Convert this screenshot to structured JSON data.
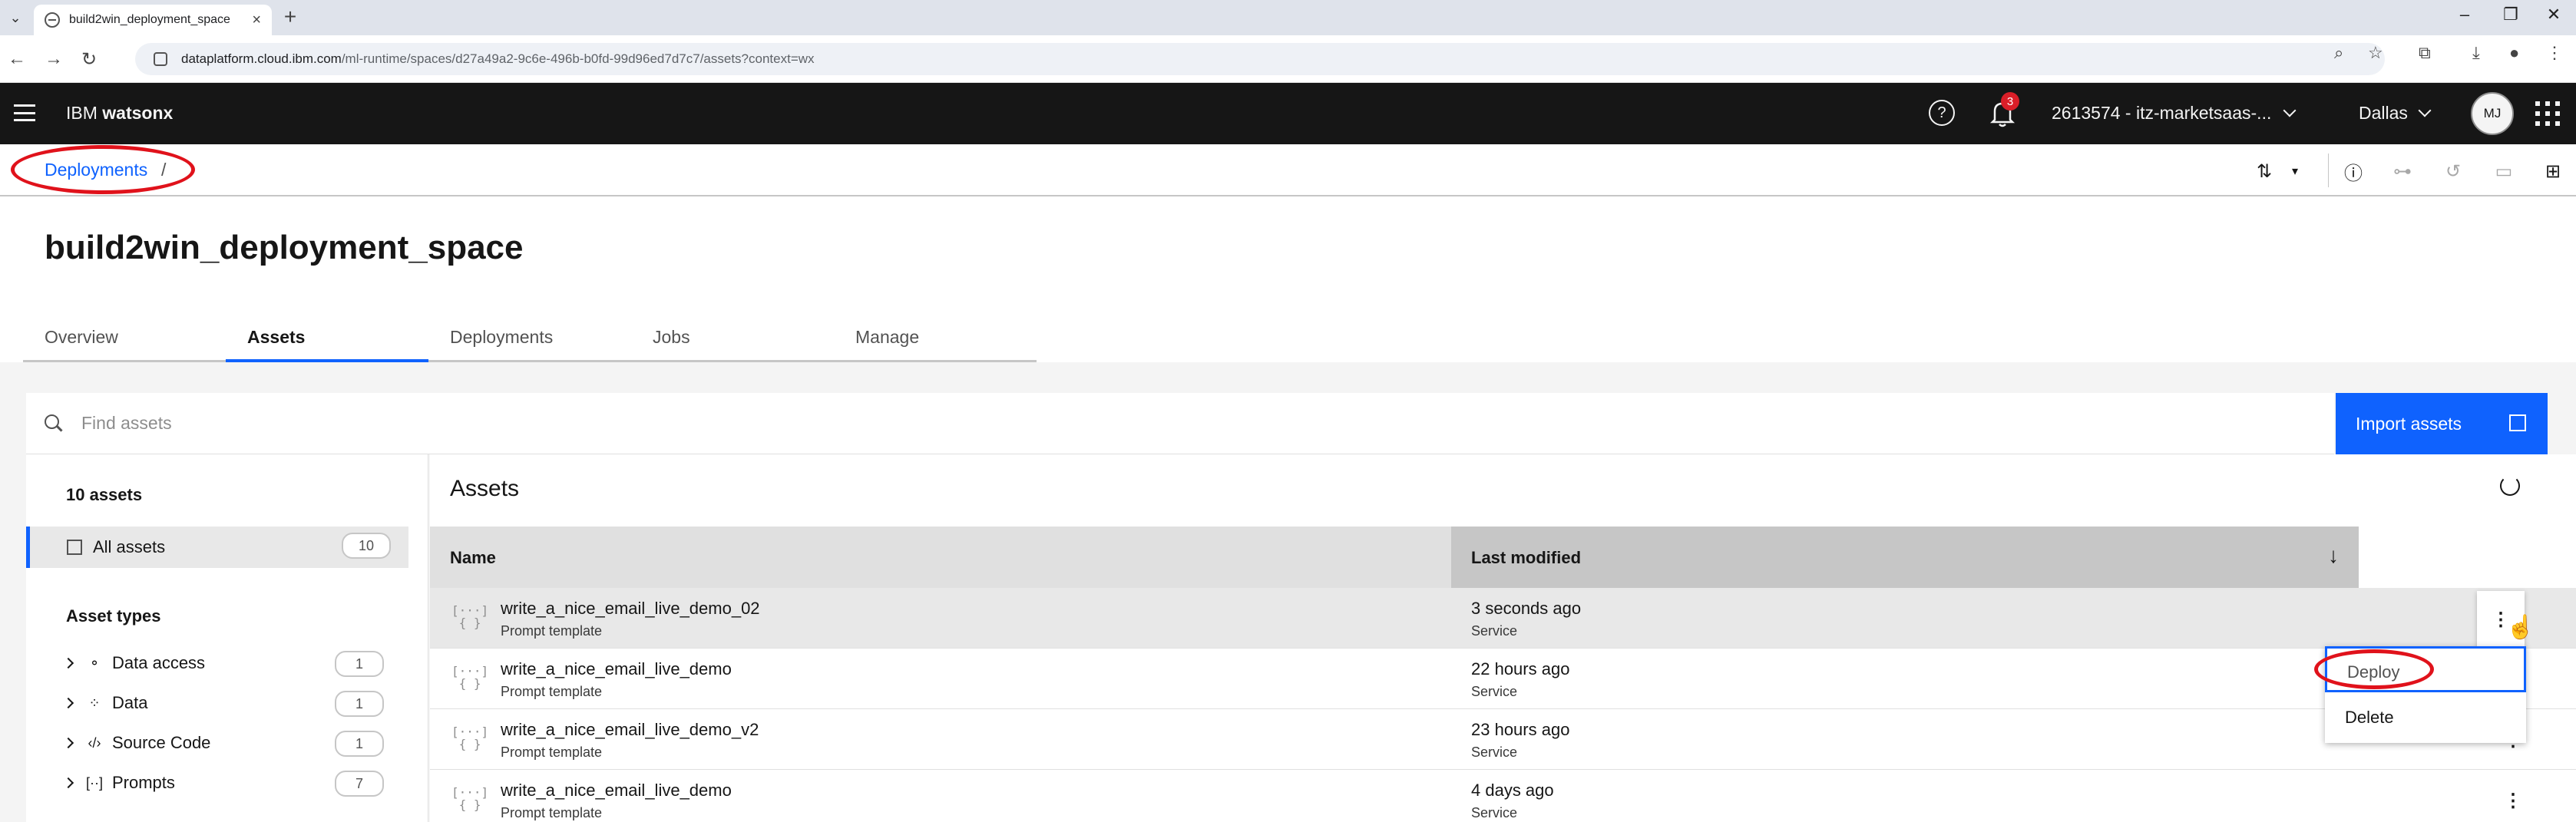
{
  "browser": {
    "tab_title": "build2win_deployment_space",
    "url_host": "dataplatform.cloud.ibm.com",
    "url_path": "/ml-runtime/spaces/d27a49a2-9c6e-496b-b0fd-99d96ed7d7c7/assets?context=wx"
  },
  "header": {
    "brand_prefix": "IBM",
    "brand_name": "watsonx",
    "notification_count": "3",
    "account": "2613574 - itz-marketsaas-...",
    "region": "Dallas",
    "avatar_initials": "MJ"
  },
  "breadcrumb": {
    "item": "Deployments",
    "separator": "/"
  },
  "page": {
    "title": "build2win_deployment_space",
    "tabs": [
      {
        "label": "Overview"
      },
      {
        "label": "Assets"
      },
      {
        "label": "Deployments"
      },
      {
        "label": "Jobs"
      },
      {
        "label": "Manage"
      }
    ]
  },
  "search": {
    "placeholder": "Find assets"
  },
  "import_button": {
    "label": "Import assets"
  },
  "sidebar": {
    "count_label": "10 assets",
    "all_assets": {
      "label": "All assets",
      "count": "10"
    },
    "types_heading": "Asset types",
    "types": [
      {
        "label": "Data access",
        "count": "1",
        "icon": "data-access-icon"
      },
      {
        "label": "Data",
        "count": "1",
        "icon": "data-icon"
      },
      {
        "label": "Source Code",
        "count": "1",
        "icon": "code-icon"
      },
      {
        "label": "Prompts",
        "count": "7",
        "icon": "prompt-icon"
      }
    ]
  },
  "main": {
    "title": "Assets",
    "columns": {
      "name": "Name",
      "modified": "Last modified"
    },
    "rows": [
      {
        "name": "write_a_nice_email_live_demo_02",
        "type": "Prompt template",
        "modified": "3 seconds ago",
        "by": "Service"
      },
      {
        "name": "write_a_nice_email_live_demo",
        "type": "Prompt template",
        "modified": "22 hours ago",
        "by": "Service"
      },
      {
        "name": "write_a_nice_email_live_demo_v2",
        "type": "Prompt template",
        "modified": "23 hours ago",
        "by": "Service"
      },
      {
        "name": "write_a_nice_email_live_demo",
        "type": "Prompt template",
        "modified": "4 days ago",
        "by": "Service"
      }
    ]
  },
  "overflow_menu": {
    "items": [
      {
        "label": "Deploy"
      },
      {
        "label": "Delete"
      }
    ]
  },
  "colors": {
    "accent": "#0f62fe",
    "header_bg": "#161616",
    "annotation": "#e0121b"
  }
}
